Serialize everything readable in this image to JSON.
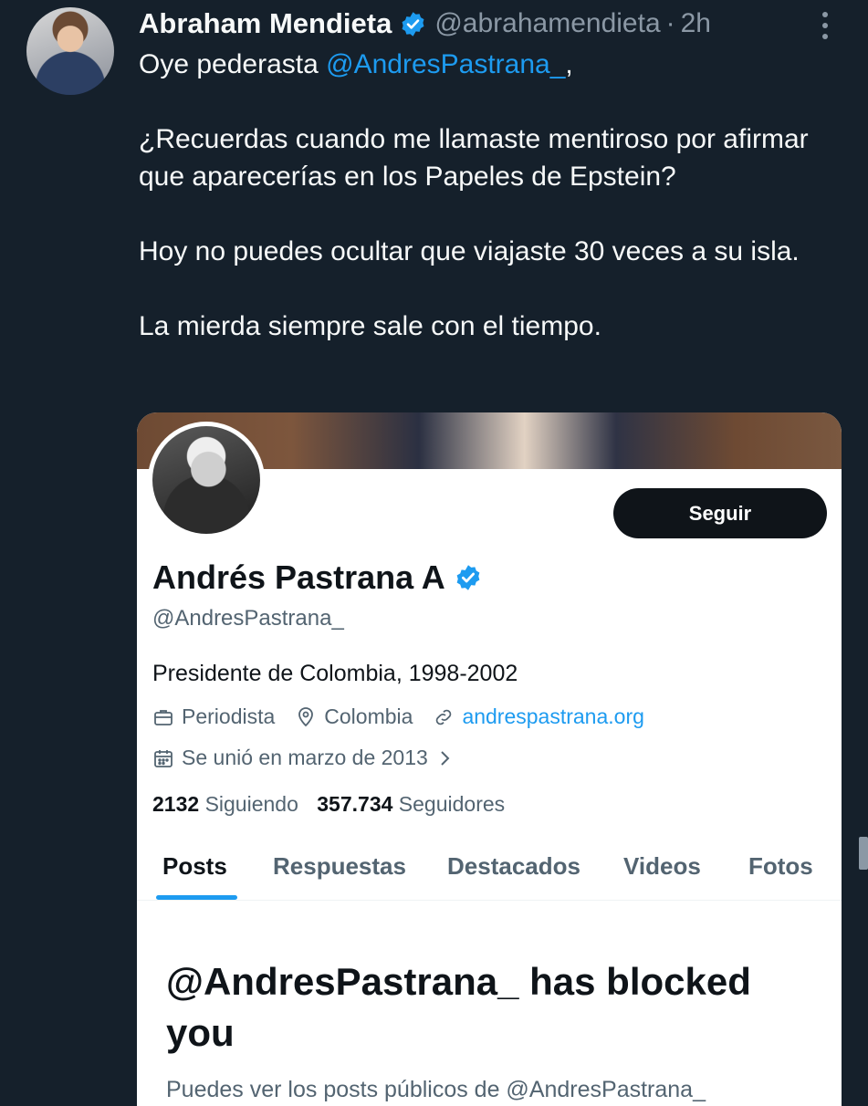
{
  "tweet": {
    "author_name": "Abraham Mendieta",
    "author_handle": "@abrahamendieta",
    "separator": "·",
    "time": "2h",
    "text_line1_prefix": "Oye pederasta ",
    "text_line1_mention": "@AndresPastrana_",
    "text_line1_suffix": ",",
    "text_para2": "¿Recuerdas cuando me llamaste mentiroso por afirmar que aparecerías en los Papeles de Epstein?",
    "text_para3": "Hoy no puedes ocultar que viajaste 30 veces a su isla.",
    "text_para4": "La mierda siempre sale con el tiempo."
  },
  "profile": {
    "name": "Andrés Pastrana A",
    "handle": "@AndresPastrana_",
    "follow_label": "Seguir",
    "bio": "Presidente de Colombia, 1998-2002",
    "profession": "Periodista",
    "location": "Colombia",
    "website": "andrespastrana.org",
    "joined": "Se unió en marzo de 2013",
    "following_count": "2132",
    "following_label": "Siguiendo",
    "followers_count": "357.734",
    "followers_label": "Seguidores",
    "tabs": [
      "Posts",
      "Respuestas",
      "Destacados",
      "Videos",
      "Fotos"
    ],
    "blocked_title": "@AndresPastrana_ has blocked you",
    "blocked_subtitle": "Puedes ver los posts públicos de @AndresPastrana_"
  },
  "colors": {
    "background": "#15202b",
    "accent": "#1d9bf0",
    "secondary_text": "#8b98a5"
  },
  "icons": [
    "verified-badge-icon",
    "more-options-icon",
    "briefcase-icon",
    "location-pin-icon",
    "link-icon",
    "calendar-icon",
    "chevron-right-icon"
  ]
}
